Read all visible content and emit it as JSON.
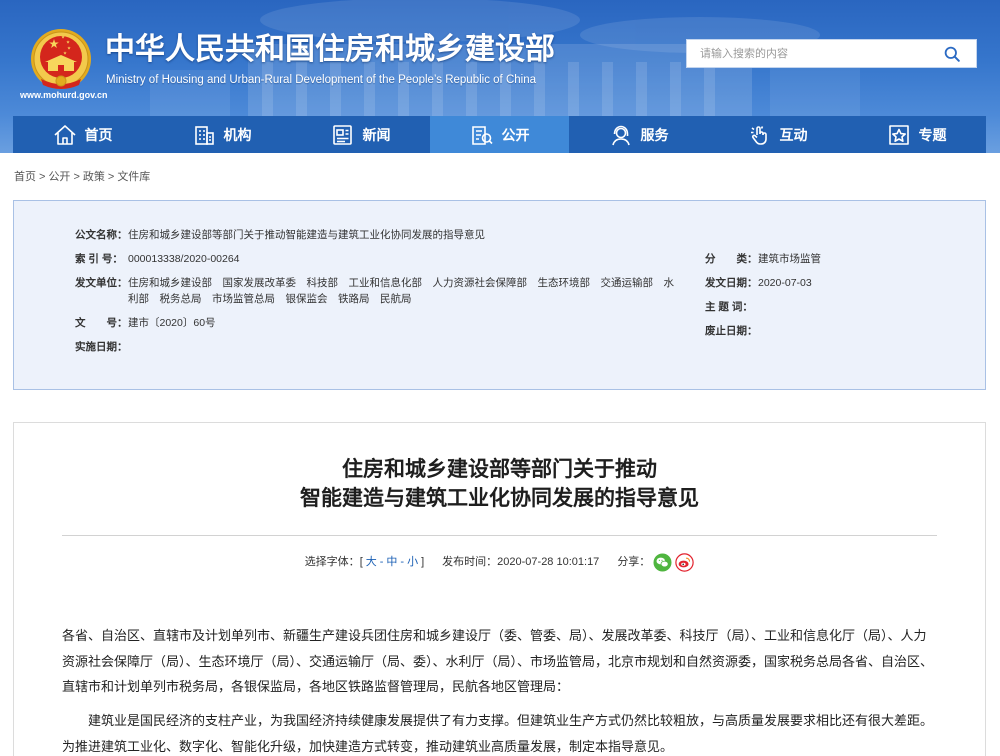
{
  "site": {
    "title": "中华人民共和国住房和城乡建设部",
    "subtitle": "Ministry of Housing and Urban-Rural Development of the People’s Republic of China",
    "domain": "www.mohurd.gov.cn",
    "emblem_icon": "national-emblem-icon"
  },
  "search": {
    "placeholder": "请输入搜索的内容",
    "icon": "search-icon"
  },
  "nav": {
    "items": [
      {
        "label": "首页",
        "icon": "home-icon"
      },
      {
        "label": "机构",
        "icon": "organization-icon"
      },
      {
        "label": "新闻",
        "icon": "news-icon"
      },
      {
        "label": "公开",
        "icon": "disclosure-icon",
        "active": true
      },
      {
        "label": "服务",
        "icon": "service-icon"
      },
      {
        "label": "互动",
        "icon": "interaction-icon"
      },
      {
        "label": "专题",
        "icon": "topic-icon"
      }
    ]
  },
  "breadcrumb": {
    "items": [
      "首页",
      "公开",
      "政策",
      "文件库"
    ],
    "separator": ">"
  },
  "info": {
    "name_label": "公文名称：",
    "name": "住房和城乡建设部等部门关于推动智能建造与建筑工业化协同发展的指导意见",
    "index_label": "索 引 号：",
    "index": "000013338/2020-00264",
    "issuer_label": "发文单位：",
    "issuer": "住房和城乡建设部　国家发展改革委　科技部　工业和信息化部　人力资源社会保障部　生态环境部　交通运输部　水利部　税务总局　市场监管总局　银保监会　铁路局　民航局",
    "docno_label": "文　　号：",
    "docno": "建市〔2020〕60号",
    "effective_label": "实施日期：",
    "category_label": "分　　类：",
    "category": "建筑市场监管",
    "issue_date_label": "发文日期：",
    "issue_date": "2020-07-03",
    "keywords_label": "主 题 词：",
    "expiry_label": "废止日期："
  },
  "article": {
    "title_lines": [
      "住房和城乡建设部等部门关于推动",
      "智能建造与建筑工业化协同发展的指导意见"
    ],
    "font_label": "选择字体：",
    "font_open": "[",
    "font_sizes": [
      "大",
      "中",
      "小"
    ],
    "font_sep": "-",
    "font_close": "]",
    "publish_label": "发布时间：",
    "publish_time": "2020-07-28 10:01:17",
    "share_label": "分享：",
    "share_icons": [
      "wechat-icon",
      "weibo-icon"
    ],
    "paragraphs": [
      "各省、自治区、直辖市及计划单列市、新疆生产建设兵团住房和城乡建设厅（委、管委、局）、发展改革委、科技厅（局）、工业和信息化厅（局）、人力资源社会保障厅（局）、生态环境厅（局）、交通运输厅（局、委）、水利厅（局）、市场监管局，北京市规划和自然资源委，国家税务总局各省、自治区、直辖市和计划单列市税务局，各银保监局，各地区铁路监督管理局，民航各地区管理局：",
      "建筑业是国民经济的支柱产业，为我国经济持续健康发展提供了有力支撑。但建筑业生产方式仍然比较粗放，与高质量发展要求相比还有很大差距。为推进建筑工业化、数字化、智能化升级，加快建造方式转变，推动建筑业高质量发展，制定本指导意见。"
    ]
  },
  "colors": {
    "header_blue": "#2a66c0",
    "nav_blue": "#2160b2",
    "nav_active": "#3f89d8",
    "info_bg": "#edf2fb",
    "info_border": "#a9c1e5",
    "link_blue": "#1a5fb4",
    "wechat_green": "#4fb53f",
    "weibo_red": "#e2232e"
  }
}
